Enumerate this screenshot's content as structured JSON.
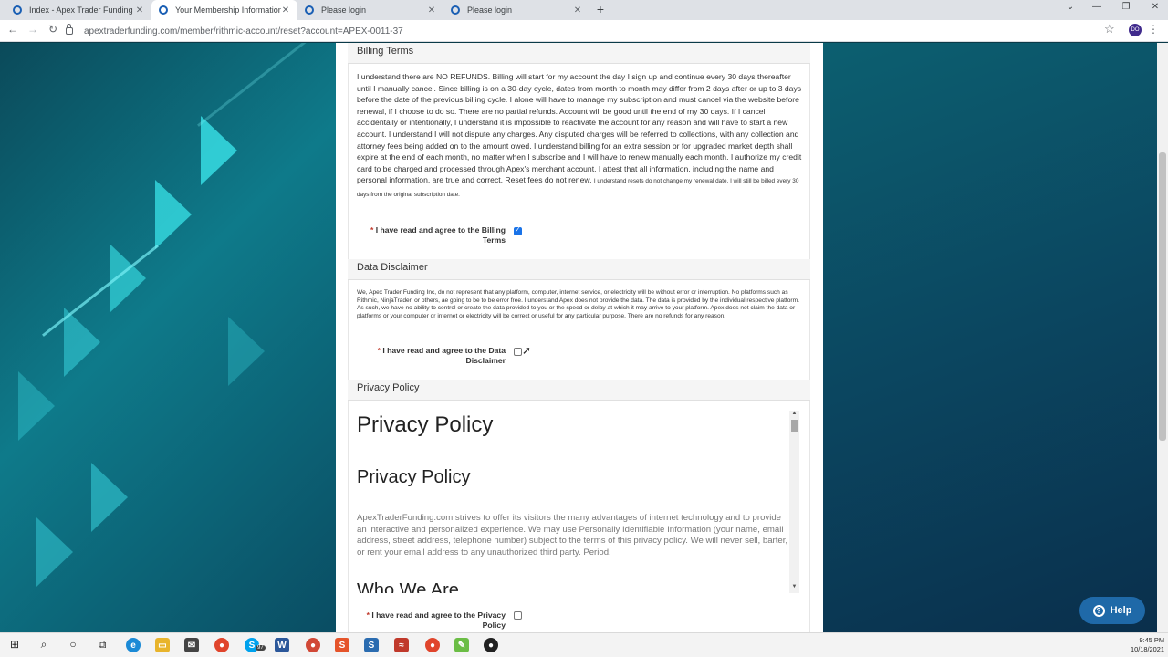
{
  "browser": {
    "tabs": [
      {
        "title": "Index - Apex Trader Funding",
        "active": false
      },
      {
        "title": "Your Membership Information",
        "active": true
      },
      {
        "title": "Please login",
        "active": false
      },
      {
        "title": "Please login",
        "active": false
      }
    ],
    "new_tab": "+",
    "url": "apextraderfunding.com/member/rithmic-account/reset?account=APEX-0011-37",
    "profile_initials": "DO",
    "icons": [
      "back-arrow-icon",
      "forward-arrow-icon",
      "reload-icon",
      "lock-icon",
      "star-icon",
      "kebab-menu-icon"
    ]
  },
  "billing": {
    "header": "Billing Terms",
    "text": "I understand there are NO REFUNDS. Billing will start for my account the day I sign up and continue every 30 days thereafter until I manually cancel. Since billing is on a 30-day cycle, dates from month to month may differ from 2 days after or up to 3 days before the date of the previous billing cycle. I alone will have to manage my subscription and must cancel via the website before renewal, if I choose to do so. There are no partial refunds.  Account will be good until the end of my 30 days. If I cancel accidentally or intentionally, I understand it is impossible to reactivate the account for any reason and will have to start a new account. I understand I will not dispute any charges. Any disputed charges will be referred to collections, with any collection and attorney fees being added on to the amount owed. I understand billing for an extra session or for upgraded market depth shall expire at the end of each month, no matter when I subscribe and I will have to renew manually each month. I authorize my credit card to be charged and processed through Apex's merchant account. I attest that all information, including the name and personal information, are true and correct.  Reset fees do not renew.",
    "small_text": "I understand resets do not change my renewal date. I will still be billed every 30 days from the original subscription date.",
    "agree_label": "I have read and agree to the Billing Terms",
    "agree_line1": "I have read and agree to the Billing",
    "agree_line2": "Terms",
    "checked": true
  },
  "disclaimer": {
    "header": "Data Disclaimer",
    "text": "We, Apex Trader Funding Inc, do not represent that any platform, computer, internet service, or electricity will be without error or interruption. No platforms such as Rithmic, NinjaTrader, or others, ae going to be to be error free. I understand Apex does not provide the data. The data is provided by the individual respective platform. As such, we have no ability to control or create the data provided to you or the speed or delay at which it may arrive to your platform. Apex does not claim the data or platforms or your computer or internet or electricity will be correct or useful for any particular purpose. There are no refunds for any reason.",
    "agree_line1": "I have read and agree to the Data",
    "agree_line2": "Disclaimer",
    "checked": false
  },
  "privacy": {
    "header": "Privacy Policy",
    "h1": "Privacy Policy",
    "h2": "Privacy Policy",
    "body": "ApexTraderFunding.com strives to offer its visitors the many advantages of internet technology and to provide an interactive and personalized experience. We may use Personally Identifiable Information (your name, email address, street address, telephone number) subject to the terms of this privacy policy. We will never sell, barter, or rent your email address to any unauthorized third party. Period.",
    "h3": "Who We Are",
    "agree_line1": "I have read and agree to the Privacy",
    "agree_line2": "Policy",
    "checked": false
  },
  "required_mark": "*",
  "help_label": "Help",
  "taskbar": {
    "skype_badge": "97",
    "time": "9:45 PM",
    "date": "10/18/2021"
  }
}
